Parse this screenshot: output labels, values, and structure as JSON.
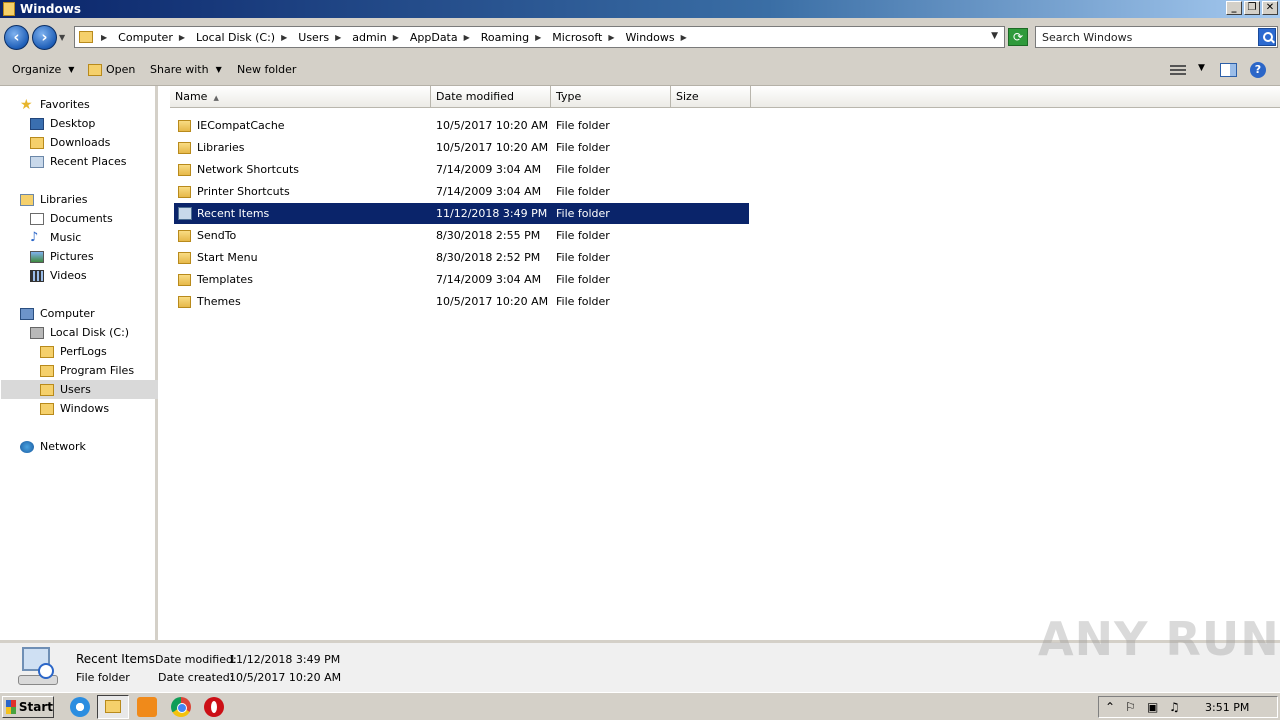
{
  "window": {
    "title": "Windows"
  },
  "window_buttons": {
    "minimize": "_",
    "maximize": "❐",
    "close": "✕"
  },
  "address": {
    "breadcrumbs": [
      "Computer",
      "Local Disk (C:)",
      "Users",
      "admin",
      "AppData",
      "Roaming",
      "Microsoft",
      "Windows"
    ],
    "search_placeholder": "Search Windows"
  },
  "commands": {
    "organize": "Organize",
    "open": "Open",
    "share_with": "Share with",
    "new_folder": "New folder"
  },
  "nav": {
    "favorites": "Favorites",
    "desktop": "Desktop",
    "downloads": "Downloads",
    "recent_places": "Recent Places",
    "libraries": "Libraries",
    "documents": "Documents",
    "music": "Music",
    "pictures": "Pictures",
    "videos": "Videos",
    "computer": "Computer",
    "local_disk": "Local Disk (C:)",
    "perflogs": "PerfLogs",
    "program_files": "Program Files",
    "users": "Users",
    "windows": "Windows",
    "network": "Network"
  },
  "columns": {
    "name": "Name",
    "date_modified": "Date modified",
    "type": "Type",
    "size": "Size"
  },
  "files": [
    {
      "name": "IECompatCache",
      "date": "10/5/2017 10:20 AM",
      "type": "File folder"
    },
    {
      "name": "Libraries",
      "date": "10/5/2017 10:20 AM",
      "type": "File folder"
    },
    {
      "name": "Network Shortcuts",
      "date": "7/14/2009 3:04 AM",
      "type": "File folder"
    },
    {
      "name": "Printer Shortcuts",
      "date": "7/14/2009 3:04 AM",
      "type": "File folder"
    },
    {
      "name": "Recent Items",
      "date": "11/12/2018 3:49 PM",
      "type": "File folder"
    },
    {
      "name": "SendTo",
      "date": "8/30/2018 2:55 PM",
      "type": "File folder"
    },
    {
      "name": "Start Menu",
      "date": "8/30/2018 2:52 PM",
      "type": "File folder"
    },
    {
      "name": "Templates",
      "date": "7/14/2009 3:04 AM",
      "type": "File folder"
    },
    {
      "name": "Themes",
      "date": "10/5/2017 10:20 AM",
      "type": "File folder"
    }
  ],
  "details": {
    "name": "Recent Items",
    "type": "File folder",
    "modified_label": "Date modified:",
    "modified_value": "11/12/2018 3:49 PM",
    "created_label": "Date created:",
    "created_value": "10/5/2017 10:20 AM"
  },
  "watermark": "ANY RUN",
  "taskbar": {
    "start": "Start",
    "clock": "3:51 PM"
  }
}
